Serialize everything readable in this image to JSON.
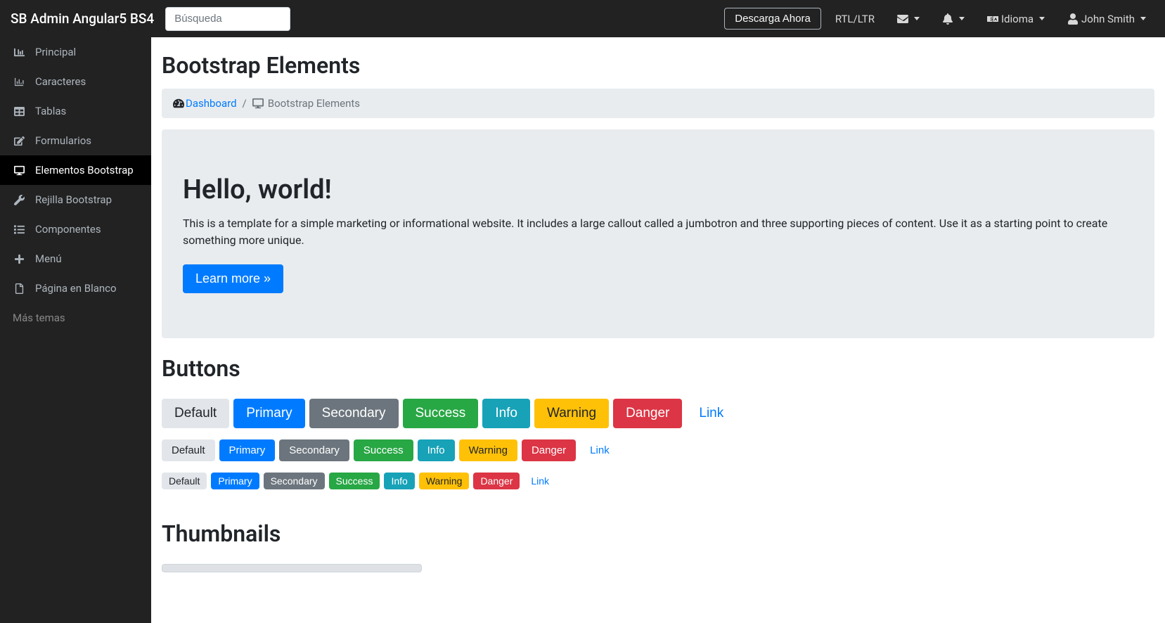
{
  "navbar": {
    "brand": "SB Admin Angular5 BS4",
    "search_placeholder": "Búsqueda",
    "download_label": "Descarga Ahora",
    "rtl_label": "RTL/LTR",
    "language_label": "Idioma",
    "user_label": "John Smith"
  },
  "sidebar": {
    "items": [
      {
        "label": "Principal",
        "icon": "dashboard-icon"
      },
      {
        "label": "Caracteres",
        "icon": "bar-chart-icon"
      },
      {
        "label": "Tablas",
        "icon": "table-icon"
      },
      {
        "label": "Formularios",
        "icon": "edit-icon"
      },
      {
        "label": "Elementos Bootstrap",
        "icon": "desktop-icon"
      },
      {
        "label": "Rejilla Bootstrap",
        "icon": "wrench-icon"
      },
      {
        "label": "Componentes",
        "icon": "list-icon"
      },
      {
        "label": "Menú",
        "icon": "plus-icon"
      },
      {
        "label": "Página en Blanco",
        "icon": "file-icon"
      }
    ],
    "more_themes": "Más temas"
  },
  "page": {
    "title": "Bootstrap Elements",
    "breadcrumb_home": "Dashboard",
    "breadcrumb_current": "Bootstrap Elements"
  },
  "jumbotron": {
    "heading": "Hello, world!",
    "body": "This is a template for a simple marketing or informational website. It includes a large callout called a jumbotron and three supporting pieces of content. Use it as a starting point to create something more unique.",
    "button_label": "Learn more »"
  },
  "buttons": {
    "section_title": "Buttons",
    "labels": {
      "default": "Default",
      "primary": "Primary",
      "secondary": "Secondary",
      "success": "Success",
      "info": "Info",
      "warning": "Warning",
      "danger": "Danger",
      "link": "Link"
    }
  },
  "thumbnails": {
    "section_title": "Thumbnails"
  }
}
